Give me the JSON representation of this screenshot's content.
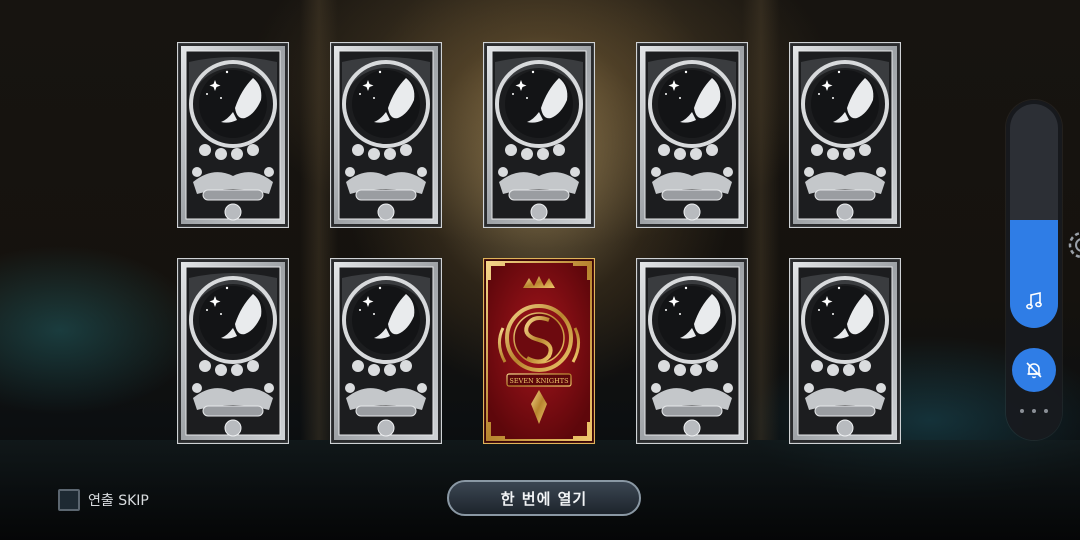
{
  "cards": [
    {
      "face": "back"
    },
    {
      "face": "back"
    },
    {
      "face": "back"
    },
    {
      "face": "back"
    },
    {
      "face": "back"
    },
    {
      "face": "back"
    },
    {
      "face": "back"
    },
    {
      "face": "revealed",
      "emblem_text": "SEVEN KNIGHTS"
    },
    {
      "face": "back"
    },
    {
      "face": "back"
    }
  ],
  "controls": {
    "skip_label": "연출 SKIP",
    "skip_checked": false,
    "open_all_label": "한 번에 열기"
  },
  "side_panel": {
    "volume_level": 0.48,
    "music_icon": "music-note-icon",
    "notification_icon": "bell-off-icon",
    "more_icon": "more-dots-icon"
  },
  "colors": {
    "accent_blue": "#2f7de6",
    "card_silver": "#b9bcc0",
    "card_red": "#8e1016",
    "card_gold": "#d7a84a"
  }
}
